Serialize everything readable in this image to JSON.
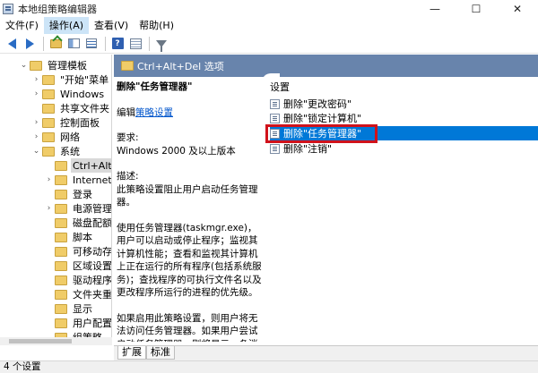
{
  "window": {
    "title": "本地组策略编辑器",
    "minimize_glyph": "—",
    "maximize_glyph": "☐",
    "close_glyph": "✕"
  },
  "menu": [
    "文件(F)",
    "操作(A)",
    "查看(V)",
    "帮助(H)"
  ],
  "tree": {
    "items": [
      {
        "label": "管理模板",
        "expander": "⌄",
        "indent": 22
      },
      {
        "label": "\"开始\"菜单",
        "expander": "›",
        "indent": 36
      },
      {
        "label": "Windows",
        "expander": "›",
        "indent": 36
      },
      {
        "label": "共享文件夹",
        "expander": "",
        "indent": 36
      },
      {
        "label": "控制面板",
        "expander": "›",
        "indent": 36
      },
      {
        "label": "网络",
        "expander": "›",
        "indent": 36
      },
      {
        "label": "系统",
        "expander": "⌄",
        "indent": 36
      },
      {
        "label": "Ctrl+Alt+Del 选项",
        "expander": "",
        "indent": 50,
        "selected": true
      },
      {
        "label": "Internet 通信管理",
        "expander": "›",
        "indent": 50
      },
      {
        "label": "登录",
        "expander": "",
        "indent": 50
      },
      {
        "label": "电源管理",
        "expander": "›",
        "indent": 50
      },
      {
        "label": "磁盘配额",
        "expander": "",
        "indent": 50
      },
      {
        "label": "脚本",
        "expander": "",
        "indent": 50
      },
      {
        "label": "可移动存储访问",
        "expander": "",
        "indent": 50
      },
      {
        "label": "区域设置服务",
        "expander": "",
        "indent": 50
      },
      {
        "label": "驱动程序安装",
        "expander": "",
        "indent": 50
      },
      {
        "label": "文件夹重定向",
        "expander": "",
        "indent": 50
      },
      {
        "label": "显示",
        "expander": "",
        "indent": 50
      },
      {
        "label": "用户配置文件",
        "expander": "",
        "indent": 50
      },
      {
        "label": "组策略",
        "expander": "",
        "indent": 50
      }
    ]
  },
  "right_header": {
    "title": "Ctrl+Alt+Del 选项"
  },
  "description": {
    "heading": "删除\"任务管理器\"",
    "edit_prefix": "编辑",
    "edit_link": "策略设置",
    "requirement_label": "要求:",
    "requirement_value": "Windows 2000 及以上版本",
    "desc_label": "描述:",
    "desc_text": "此策略设置阻止用户启动任务管理器。",
    "para2": "使用任务管理器(taskmgr.exe)，用户可以启动或停止程序；监视其计算机性能；查看和监视其计算机上正在运行的所有程序(包括系统服务)；查找程序的可执行文件名以及更改程序所运行的进程的优先级。",
    "para3": "如果启用此策略设置，则用户将无法访问任务管理器。如果用户尝试启动任务管理器，则将显示一条消息，解释策略阻止该操作。"
  },
  "settings": {
    "column_title": "设置",
    "items": [
      {
        "label": "删除\"更改密码\"",
        "selected": false
      },
      {
        "label": "删除\"锁定计算机\"",
        "selected": false
      },
      {
        "label": "删除\"任务管理器\"",
        "selected": true
      },
      {
        "label": "删除\"注销\"",
        "selected": false
      }
    ]
  },
  "tabs": [
    "扩展",
    "标准"
  ],
  "status": {
    "text": "4 个设置"
  },
  "colors": {
    "header_bg": "#6884ac",
    "selection": "#0078d7",
    "highlight_border": "#d0121b",
    "link": "#0055cc"
  }
}
